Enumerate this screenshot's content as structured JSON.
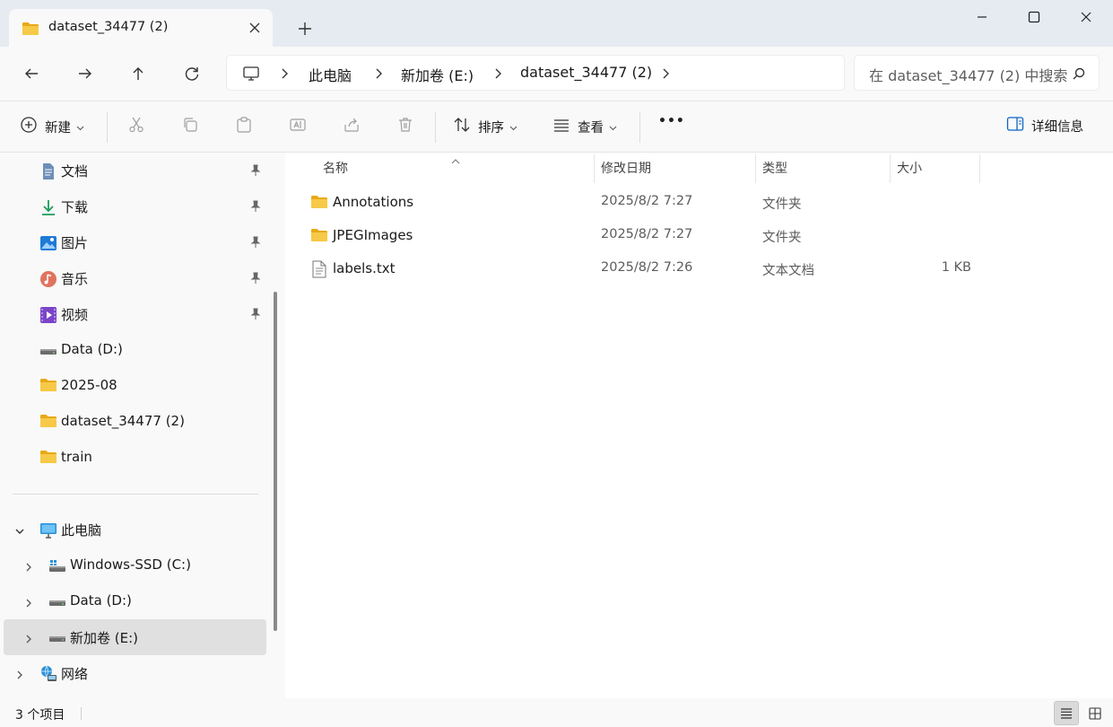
{
  "window": {
    "tab_title": "dataset_34477 (2)",
    "tab_close_icon": "close-icon",
    "new_tab_icon": "plus-icon",
    "controls": [
      "minimize-icon",
      "maximize-icon",
      "close-icon"
    ]
  },
  "address": {
    "breadcrumbs": [
      "此电脑",
      "新加卷 (E:)",
      "dataset_34477 (2)"
    ],
    "computer_icon": "monitor-icon",
    "search_placeholder": "在 dataset_34477 (2) 中搜索"
  },
  "toolbar": {
    "new_label": "新建",
    "sort_label": "排序",
    "view_label": "查看",
    "more_label": "•••",
    "details_label": "详细信息"
  },
  "nav": {
    "quick_access": [
      {
        "label": "文档",
        "icon": "document-icon",
        "pinned": true
      },
      {
        "label": "下载",
        "icon": "download-icon",
        "pinned": true
      },
      {
        "label": "图片",
        "icon": "pictures-icon",
        "pinned": true
      },
      {
        "label": "音乐",
        "icon": "music-icon",
        "pinned": true
      },
      {
        "label": "视频",
        "icon": "video-icon",
        "pinned": true
      },
      {
        "label": "Data (D:)",
        "icon": "drive-icon",
        "pinned": false
      },
      {
        "label": "2025-08",
        "icon": "folder-icon",
        "pinned": false
      },
      {
        "label": "dataset_34477 (2)",
        "icon": "folder-icon",
        "pinned": false
      },
      {
        "label": "train",
        "icon": "folder-icon",
        "pinned": false
      }
    ],
    "this_pc": "此电脑",
    "drives": [
      {
        "label": "Windows-SSD (C:)",
        "icon": "windows-drive-icon",
        "selected": false
      },
      {
        "label": "Data (D:)",
        "icon": "drive-icon",
        "selected": false
      },
      {
        "label": "新加卷 (E:)",
        "icon": "drive-icon",
        "selected": true
      }
    ],
    "network": "网络"
  },
  "columns": {
    "name": "名称",
    "modified": "修改日期",
    "type": "类型",
    "size": "大小"
  },
  "files": [
    {
      "name": "Annotations",
      "modified": "2025/8/2 7:27",
      "type": "文件夹",
      "size": "",
      "icon": "folder-icon"
    },
    {
      "name": "JPEGImages",
      "modified": "2025/8/2 7:27",
      "type": "文件夹",
      "size": "",
      "icon": "folder-icon"
    },
    {
      "name": "labels.txt",
      "modified": "2025/8/2 7:26",
      "type": "文本文档",
      "size": "1 KB",
      "icon": "text-file-icon"
    }
  ],
  "status": {
    "item_count": "3 个项目"
  },
  "colors": {
    "folder": "#f7c948",
    "folder_dark": "#e8a916",
    "accent": "#0a64c8",
    "title_bg": "#e6ebf2"
  }
}
